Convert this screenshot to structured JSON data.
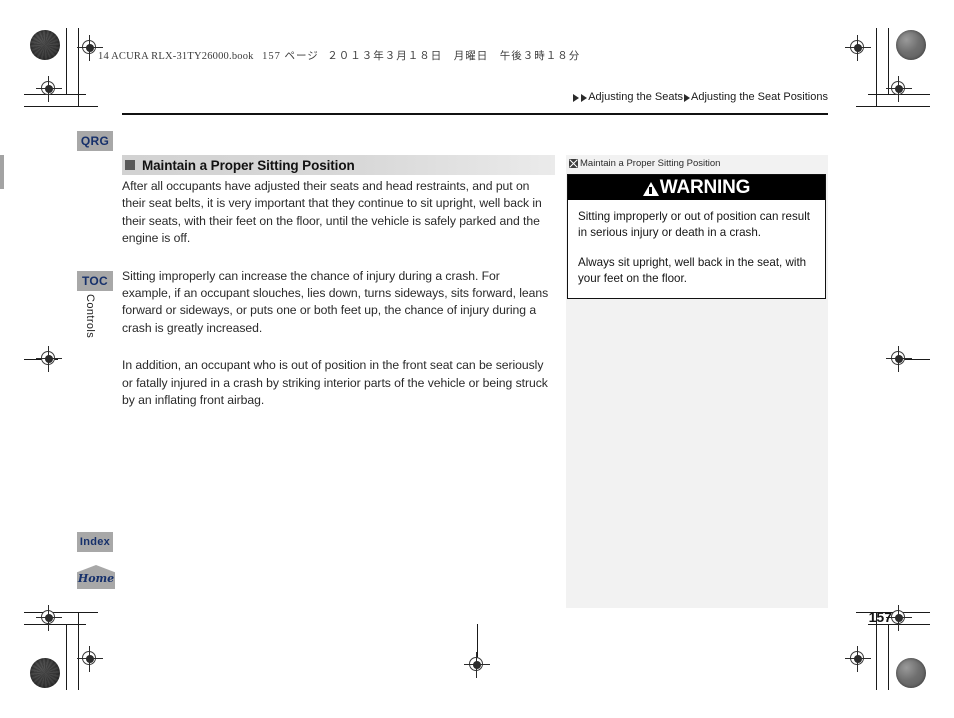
{
  "print_header": {
    "file_slug_latin": "14 ACURA RLX-31TY26000.book",
    "file_slug_page": "157 ページ",
    "file_slug_date": "２０１３年３月１８日　月曜日　午後３時１８分"
  },
  "breadcrumb": {
    "level1": "Adjusting the Seats",
    "level2": "Adjusting the Seat Positions"
  },
  "sidebar_nav": {
    "qrg": "QRG",
    "toc": "TOC",
    "chapter": "Controls",
    "index": "Index",
    "home": "Home"
  },
  "main": {
    "section_title": "Maintain a Proper Sitting Position",
    "paragraphs": [
      "After all occupants have adjusted their seats and head restraints, and put on their seat belts, it is very important that they continue to sit upright, well back in their seats, with their feet on the floor, until the vehicle is safely parked and the engine is off.",
      "Sitting improperly can increase the chance of injury during a crash. For example, if an occupant slouches, lies down, turns sideways, sits forward, leans forward or sideways, or puts one or both feet up, the chance of injury during a crash is greatly increased.",
      "In addition, an occupant who is out of position in the front seat can be seriously or fatally injured in a crash by striking interior parts of the vehicle or being struck by an inflating front airbag."
    ]
  },
  "side_panel": {
    "reference_label": "Maintain a Proper Sitting Position",
    "warning_title": "WARNING",
    "warning_paragraphs": [
      "Sitting improperly or out of position can result in serious injury or death in a crash.",
      "Always sit upright, well back in the seat, with your feet on the floor."
    ]
  },
  "page_number": "157",
  "colors": {
    "warning_bar": "#000000",
    "section_head": "#d4d4d4",
    "side_panel": "#f2f2f2",
    "tab_bg": "#a8a8a8",
    "tab_text": "#16306b"
  }
}
